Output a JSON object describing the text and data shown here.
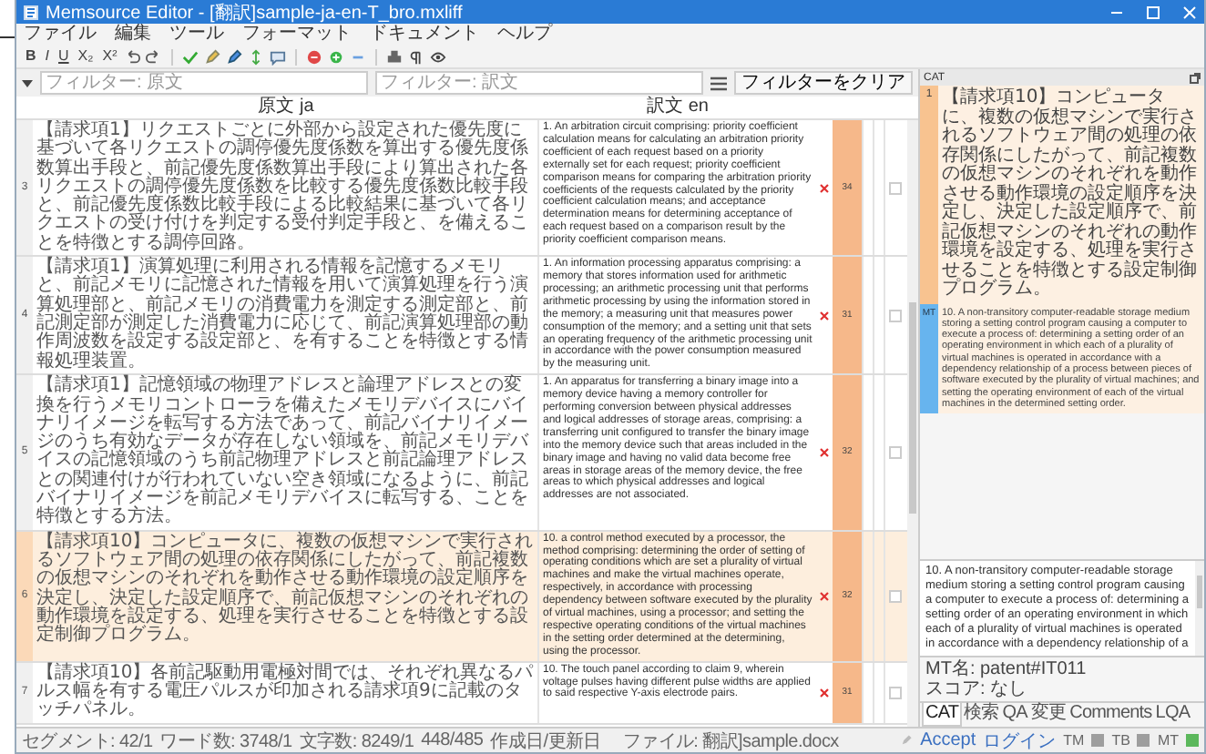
{
  "window": {
    "title": "Memsource Editor - [翻訳]sample-ja-en-T_bro.mxliff"
  },
  "menu": [
    "ファイル",
    "編集",
    "ツール",
    "フォーマット",
    "ドキュメント",
    "ヘルプ"
  ],
  "format_buttons": [
    "B",
    "I",
    "U",
    "X₂",
    "X²"
  ],
  "filter": {
    "source_placeholder": "フィルター: 原文",
    "target_placeholder": "フィルター: 訳文",
    "clear_button": "フィルターをクリア"
  },
  "table": {
    "columns": [
      "原文 ja",
      "訳文 en"
    ],
    "rows": [
      {
        "number": "3",
        "selected": false,
        "warning": true,
        "score": "34",
        "confirmed": false,
        "source": "【請求項1】リクエストごとに外部から設定された優先度に基づいて各リクエストの調停優先度係数を算出する優先度係数算出手段と、前記優先度係数算出手段により算出された各リクエストの調停優先度係数を比較する優先度係数比較手段と、前記優先度係数比較手段による比較結果に基づいて各リクエストの受け付けを判定する受付判定手段と、を備えることを特徴とする調停回路。",
        "target": "1. An arbitration circuit comprising: priority coefficient calculation means for calculating an arbitration priority coefficient of each request based on a priority externally set for each request; priority coefficient comparison means for comparing the arbitration priority coefficients of the requests calculated by the priority coefficient calculation means; and acceptance determination means for determining acceptance of each request based on a comparison result by the priority coefficient comparison means."
      },
      {
        "number": "4",
        "selected": false,
        "warning": true,
        "score": "31",
        "confirmed": false,
        "source": "【請求項1】演算処理に利用される情報を記憶するメモリと、前記メモリに記憶された情報を用いて演算処理を行う演算処理部と、前記メモリの消費電力を測定する測定部と、前記測定部が測定した消費電力に応じて、前記演算処理部の動作周波数を設定する設定部と、を有することを特徴とする情報処理装置。",
        "target": "1. An information processing apparatus comprising: a memory that stores information used for arithmetic processing; an arithmetic processing unit that performs arithmetic processing by using the information stored in the memory; a measuring unit that measures power consumption of the memory; and a setting unit that sets an operating frequency of the arithmetic processing unit in accordance with the power consumption measured by the measuring unit."
      },
      {
        "number": "5",
        "selected": false,
        "warning": true,
        "score": "32",
        "confirmed": false,
        "source": "【請求項1】記憶領域の物理アドレスと論理アドレスとの変換を行うメモリコントローラを備えたメモリデバイスにバイナリイメージを転写する方法であって、前記バイナリイメージのうち有効なデータが存在しない領域を、前記メモリデバイスの記憶領域のうち前記物理アドレスと前記論理アドレスとの関連付けが行われていない空き領域になるように、前記バイナリイメージを前記メモリデバイスに転写する、ことを特徴とする方法。",
        "target": "1. An apparatus for transferring a binary image into a memory device having a memory controller for performing conversion between physical addresses and logical addresses of storage areas, comprising: a transferring unit configured to transfer the binary image into the memory device such that areas included in the binary image and having no valid data become free areas in storage areas of the memory device, the free areas to which physical addresses and logical addresses are not associated."
      },
      {
        "number": "6",
        "selected": true,
        "warning": true,
        "score": "32",
        "confirmed": false,
        "source": "【請求項10】コンピュータに、複数の仮想マシンで実行されるソフトウェア間の処理の依存関係にしたがって、前記複数の仮想マシンのそれぞれを動作させる動作環境の設定順序を決定し、決定した設定順序で、前記仮想マシンのそれぞれの動作環境を設定する、処理を実行させることを特徴とする設定制御プログラム。",
        "target": "10. a control method executed by a processor, the method comprising: determining the order of setting of operating conditions which are set a plurality of virtual machines and make the virtual machines operate, respectively, in accordance with processing dependency between software executed by the plurality of virtual machines, using a processor; and setting the respective operating conditions of the virtual machines in the setting order determined at the determining, using the processor."
      },
      {
        "number": "7",
        "selected": false,
        "warning": true,
        "score": "31",
        "confirmed": false,
        "source": "【請求項10】各前記駆動用電極対間では、それぞれ異なるパルス幅を有する電圧パルスが印加される請求項9に記載のタッチパネル。",
        "target": "10. The touch panel according to claim 9, wherein voltage pulses having different pulse widths are applied to said respective Y-axis electrode pairs."
      }
    ]
  },
  "cat_panel": {
    "title": "CAT",
    "match": {
      "number": "1",
      "source": "【請求項10】コンピュータに、複数の仮想マシンで実行されるソフトウェア間の処理の依存関係にしたがって、前記複数の仮想マシンのそれぞれを動作させる動作環境の設定順序を決定し、決定した設定順序で、前記仮想マシンのそれぞれの動作環境を設定する、処理を実行させることを特徴とする設定制御プログラム。",
      "type": "MT",
      "target": "10. A non-transitory computer-readable storage medium storing a setting control program causing a computer to execute a process of: determining a setting order of an operating environment in which each of a plurality of virtual machines is operated in accordance with a dependency relationship of a process between pieces of software executed by the plurality of virtual machines; and setting the operating environment of each of the virtual machines in the determined setting order."
    },
    "preview": "10. A non-transitory computer-readable storage medium storing a setting control program causing a computer to execute a process of: determining a setting order of an operating environment in which each of a plurality of virtual machines is operated in accordance with a dependency relationship of a",
    "mt_name": "MT名: patent#IT011",
    "score": "スコア: なし",
    "tabs": [
      {
        "label": "CAT",
        "selected": true
      },
      {
        "label": "検索",
        "selected": false
      },
      {
        "label": "QA",
        "selected": false
      },
      {
        "label": "変更",
        "selected": false
      },
      {
        "label": "Comments",
        "selected": false
      },
      {
        "label": "LQA",
        "selected": false
      }
    ]
  },
  "status_bar": {
    "items": [
      "セグメント: 42/1",
      "ワード数: 3748/1",
      "文字数: 8249/1",
      "448/485",
      "作成日/更新日"
    ],
    "file": "ファイル: 翻訳]sample.docx",
    "accept": "Accept",
    "login": "ログイン",
    "indicators": [
      {
        "label": "TM",
        "color": "#9e9e9e"
      },
      {
        "label": "TB",
        "color": "#9e9e9e"
      },
      {
        "label": "MT",
        "color": "#5cb85c"
      }
    ]
  }
}
